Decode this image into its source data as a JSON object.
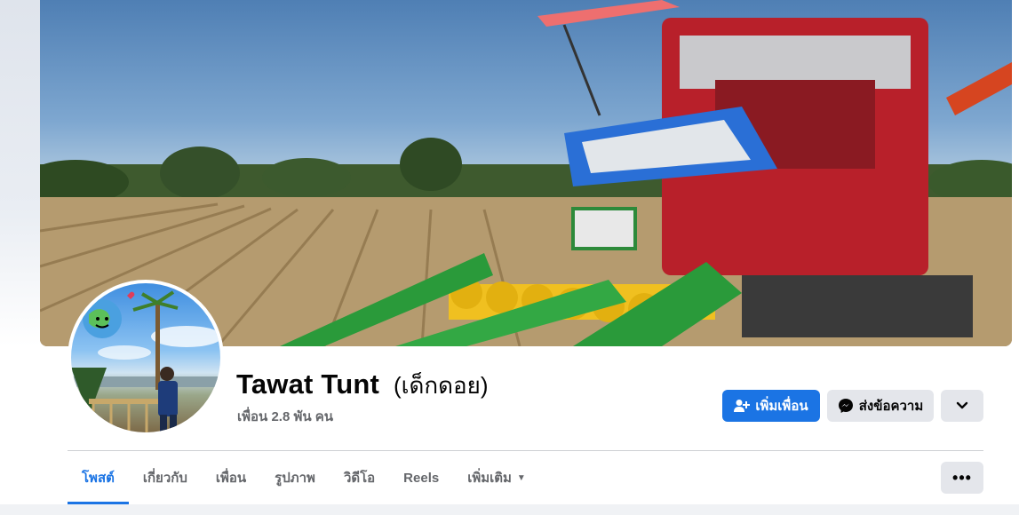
{
  "profile": {
    "name": "Tawat Tunt",
    "alternate_name": "(เด็กดอย)",
    "friends_count": "เพื่อน 2.8 พัน คน"
  },
  "actions": {
    "add_friend_label": "เพิ่มเพื่อน",
    "message_label": "ส่งข้อความ",
    "more_icon": "chevron-down-icon"
  },
  "tabs": [
    {
      "label": "โพสต์",
      "active": true
    },
    {
      "label": "เกี่ยวกับ",
      "active": false
    },
    {
      "label": "เพื่อน",
      "active": false
    },
    {
      "label": "รูปภาพ",
      "active": false
    },
    {
      "label": "วิดีโอ",
      "active": false
    },
    {
      "label": "Reels",
      "active": false
    },
    {
      "label": "เพิ่มเติม",
      "active": false
    }
  ],
  "tab_overflow_label": "•••",
  "colors": {
    "accent": "#1b74e4",
    "secondary_button": "#e4e6eb",
    "muted_text": "#65676b"
  }
}
